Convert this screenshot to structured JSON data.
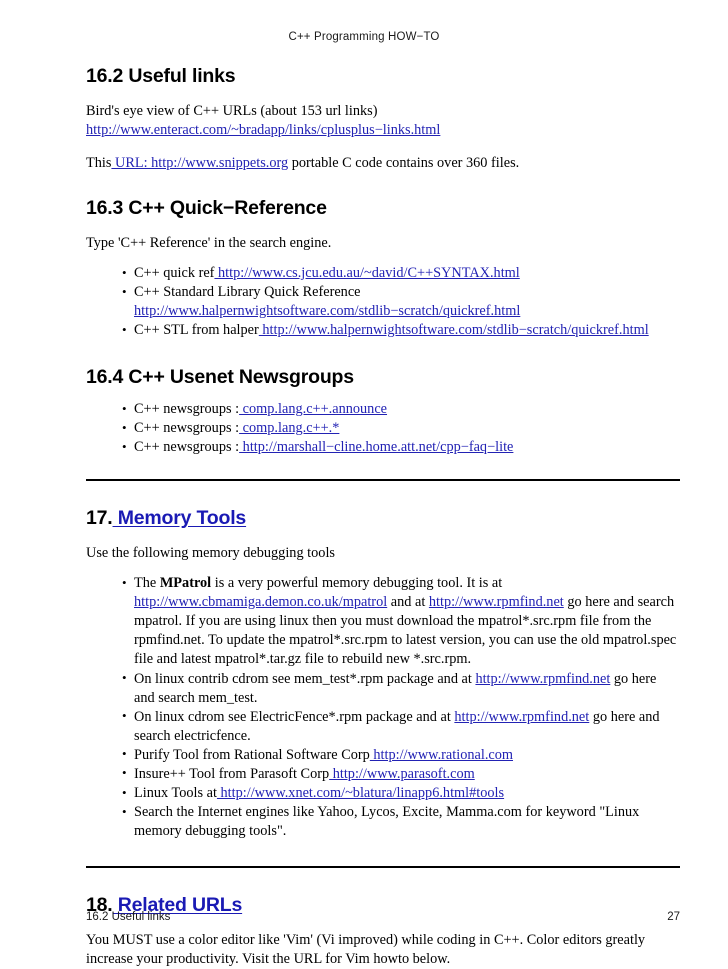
{
  "document": {
    "running_header": "C++ Programming HOW−TO",
    "footer_left": "16.2 Useful links",
    "page_number": "27",
    "colors": {
      "link": "#2222b4",
      "heading_link": "#1a1ab4",
      "text": "#000000",
      "rule": "#000000"
    }
  },
  "sections": {
    "useful_links": {
      "heading": "16.2 Useful links",
      "para1_text": "Bird's eye view of C++ URLs (about 153 url links)",
      "para1_link": "http://www.enteract.com/~bradapp/links/cplusplus−links.html",
      "para2_prefix": "This",
      "para2_link": " URL: http://www.snippets.org",
      "para2_suffix": " portable C code contains over 360 files."
    },
    "quick_reference": {
      "heading": "16.3 C++ Quick−Reference",
      "intro": "Type 'C++ Reference' in the search engine.",
      "items": [
        {
          "text": "C++ quick ref",
          "link": " http://www.cs.jcu.edu.au/~david/C++SYNTAX.html",
          "link_on_new_line": false
        },
        {
          "text": "C++ Standard Library Quick Reference",
          "link": "http://www.halpernwightsoftware.com/stdlib−scratch/quickref.html",
          "link_on_new_line": true
        },
        {
          "text": "C++ STL from halper",
          "link": " http://www.halpernwightsoftware.com/stdlib−scratch/quickref.html",
          "link_on_new_line": false
        }
      ]
    },
    "newsgroups": {
      "heading": "16.4 C++ Usenet Newsgroups",
      "items": [
        {
          "text": "C++ newsgroups :",
          "link": " comp.lang.c++.announce"
        },
        {
          "text": "C++ newsgroups :",
          "link": " comp.lang.c++.*"
        },
        {
          "text": "C++ newsgroups :",
          "link": " http://marshall−cline.home.att.net/cpp−faq−lite"
        }
      ]
    },
    "memory_tools": {
      "heading_number": "17.",
      "heading_link": " Memory Tools",
      "intro": "Use the following memory debugging tools",
      "item1": {
        "seg1": "The ",
        "bold": "MPatrol",
        "seg2": " is a very powerful memory debugging tool.  It is at ",
        "link1": "http://www.cbmamiga.demon.co.uk/mpatrol",
        "seg3": " and at ",
        "link2": " http://www.rpmfind.net",
        "seg4": " go here and search mpatrol. If you are using linux then you must download the mpatrol*.src.rpm file from the rpmfind.net. To update the mpatrol*.src.rpm to latest version, you can use the old mpatrol.spec file and latest mpatrol*.tar.gz file to rebuild new *.src.rpm."
      },
      "item2": {
        "seg1": "On linux contrib cdrom see mem_test*.rpm package and at ",
        "link": " http://www.rpmfind.net",
        "seg2": " go here and search mem_test."
      },
      "item3": {
        "seg1": "On linux cdrom see ElectricFence*.rpm package and at ",
        "link": " http://www.rpmfind.net",
        "seg2": " go here and search electricfence."
      },
      "item4": {
        "seg1": "Purify Tool from Rational Software Corp",
        "link": " http://www.rational.com"
      },
      "item5": {
        "seg1": "Insure++ Tool from Parasoft Corp",
        "link": " http://www.parasoft.com"
      },
      "item6": {
        "seg1": "Linux Tools at",
        "link": " http://www.xnet.com/~blatura/linapp6.html#tools"
      },
      "item7": {
        "seg1": "Search the Internet engines like Yahoo, Lycos, Excite, Mamma.com for keyword \"Linux memory debugging tools\"."
      }
    },
    "related_urls": {
      "heading_number": "18.",
      "heading_link": " Related URLs",
      "para": "You MUST use a color editor like 'Vim' (Vi improved) while coding in C++. Color editors greatly increase your productivity. Visit the URL for Vim howto below."
    }
  }
}
